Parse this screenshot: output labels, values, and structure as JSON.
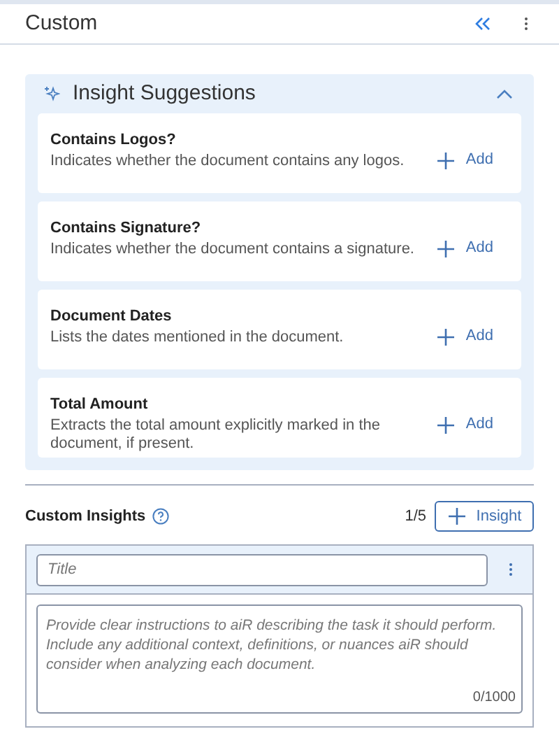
{
  "header": {
    "title": "Custom"
  },
  "suggestions": {
    "title": "Insight Suggestions",
    "expanded": true,
    "items": [
      {
        "title": "Contains Logos?",
        "description": "Indicates whether the document contains any logos.",
        "action": "Add"
      },
      {
        "title": "Contains Signature?",
        "description": "Indicates whether the document contains a signature.",
        "action": "Add"
      },
      {
        "title": "Document Dates",
        "description": "Lists the dates mentioned in the document.",
        "action": "Add"
      },
      {
        "title": "Total Amount",
        "description": "Extracts the total amount explicitly marked in the document, if present.",
        "action": "Add"
      }
    ]
  },
  "custom_insights": {
    "title": "Custom Insights",
    "count": "1/5",
    "add_button": "Insight",
    "title_field": {
      "placeholder": "Title"
    },
    "instructions_field": {
      "placeholder": "Provide clear instructions to aiR describing the task it should perform. Include any additional context, definitions, or nuances aiR should consider when analyzing each document.",
      "counter": "0/1000"
    }
  }
}
